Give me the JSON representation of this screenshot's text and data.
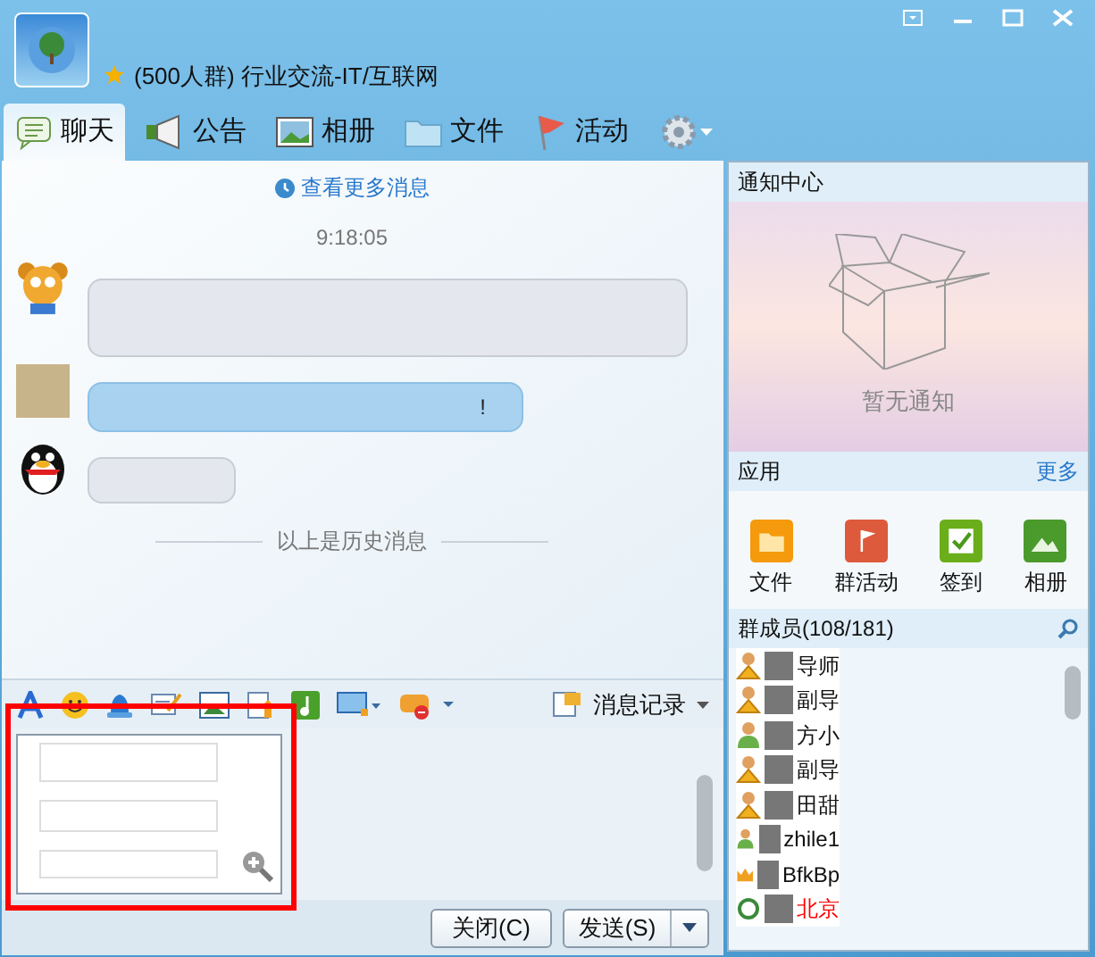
{
  "window": {
    "group_name": "(500人群) 行业交流-IT/互联网"
  },
  "tabs": [
    {
      "label": "聊天",
      "selected": true
    },
    {
      "label": "公告",
      "selected": false
    },
    {
      "label": "相册",
      "selected": false
    },
    {
      "label": "文件",
      "selected": false
    },
    {
      "label": "活动",
      "selected": false
    }
  ],
  "chat": {
    "more_link": "查看更多消息",
    "time": "9:18:05",
    "history_divider": "以上是历史消息",
    "messages": [
      {
        "kind": "gray"
      },
      {
        "kind": "blue",
        "text": "!"
      },
      {
        "kind": "gray"
      }
    ]
  },
  "toolbar": {
    "history_button": "消息记录"
  },
  "buttons": {
    "close": "关闭(C)",
    "send": "发送(S)"
  },
  "notice": {
    "title": "通知中心",
    "empty": "暂无通知"
  },
  "apps": {
    "title": "应用",
    "more": "更多",
    "items": [
      {
        "label": "文件",
        "color": "#f59a0c"
      },
      {
        "label": "群活动",
        "color": "#dd5a3c"
      },
      {
        "label": "签到",
        "color": "#6aae1c"
      },
      {
        "label": "相册",
        "color": "#4b9a2c"
      }
    ]
  },
  "members": {
    "title": "群成员(108/181)",
    "items": [
      {
        "name": "导师",
        "kind": "admin"
      },
      {
        "name": "副导",
        "kind": "admin"
      },
      {
        "name": "方小",
        "kind": "member"
      },
      {
        "name": "副导",
        "kind": "admin"
      },
      {
        "name": "田甜",
        "kind": "admin"
      },
      {
        "name": "zhile1",
        "kind": "member"
      },
      {
        "name": "BfkBp",
        "kind": "owner"
      },
      {
        "name": "北京",
        "kind": "guest"
      }
    ]
  }
}
